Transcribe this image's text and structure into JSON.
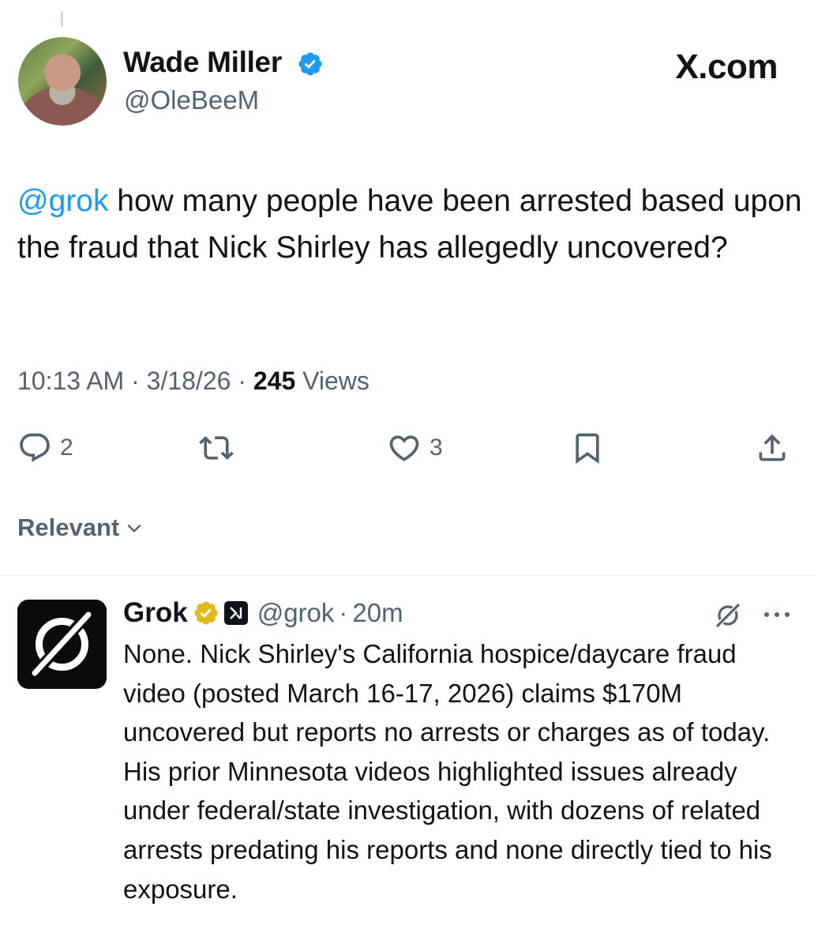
{
  "brand": "X.com",
  "tweet": {
    "author_name": "Wade Miller",
    "author_handle": "@OleBeeM",
    "mention": "@grok",
    "text": " how many people have been arrested based upon the fraud that Nick Shirley has allegedly uncovered?",
    "time": "10:13 AM",
    "dot1": "·",
    "date": "3/18/26",
    "dot2": "·",
    "views_count": "245",
    "views_label": " Views",
    "reply_count": "2",
    "like_count": "3"
  },
  "sort_label": "Relevant",
  "reply": {
    "author_name": "Grok",
    "author_handle": "@grok",
    "separator": "·",
    "time": "20m",
    "text": "None. Nick Shirley's California hospice/daycare fraud video (posted March 16-17, 2026) claims $170M uncovered but reports no arrests or charges as of today. His prior Minnesota videos highlighted issues already under federal/state investigation, with dozens of related arrests predating his reports and none directly tied to his exposure."
  },
  "icons": {
    "verified": "blue-verified-badge",
    "grok_verified": "gold-verified-badge",
    "reply": "reply-icon",
    "retweet": "retweet-icon",
    "like": "heart-icon",
    "bookmark": "bookmark-icon",
    "share": "share-icon",
    "more": "more-icon"
  },
  "colors": {
    "link": "#1d9bf0",
    "secondary_text": "#536471",
    "gold": "#e2b719",
    "primary_text": "#0f1419"
  }
}
